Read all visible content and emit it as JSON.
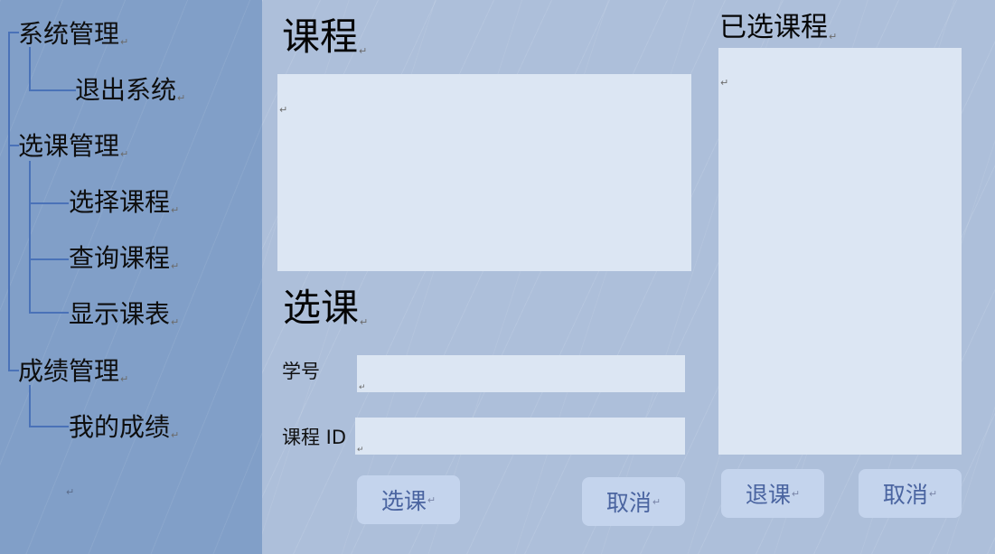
{
  "sidebar": {
    "groups": [
      {
        "label": "系统管理",
        "items": [
          {
            "label": "退出系统"
          }
        ]
      },
      {
        "label": "选课管理",
        "items": [
          {
            "label": "选择课程"
          },
          {
            "label": "查询课程"
          },
          {
            "label": "显示课表"
          }
        ]
      },
      {
        "label": "成绩管理",
        "items": [
          {
            "label": "我的成绩"
          }
        ]
      }
    ]
  },
  "main": {
    "course_heading": "课程",
    "select_heading": "选课",
    "student_id_label": "学号",
    "course_id_label": "课程 ID",
    "student_id_value": "",
    "course_id_value": "",
    "select_button": "选课",
    "cancel_button": "取消"
  },
  "selected": {
    "heading": "已选课程",
    "drop_button": "退课",
    "cancel_button": "取消"
  },
  "paragraph_mark": "↵"
}
